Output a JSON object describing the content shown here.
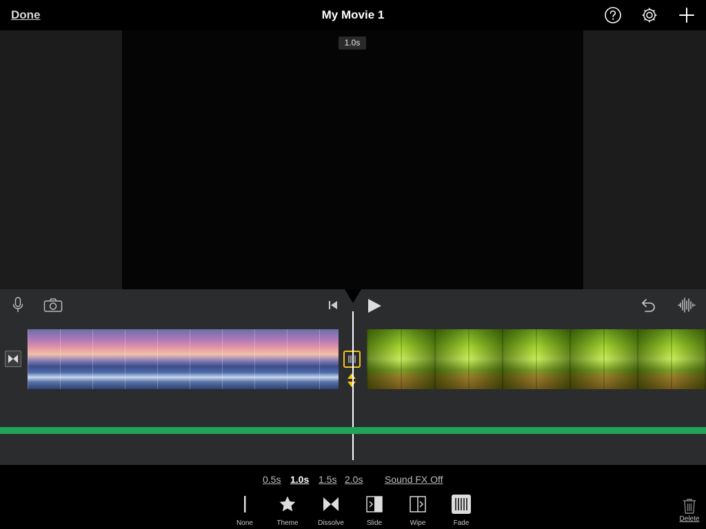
{
  "header": {
    "done_label": "Done",
    "title": "My Movie 1"
  },
  "viewer": {
    "duration_badge": "1.0s"
  },
  "transition": {
    "durations": [
      "0.5s",
      "1.0s",
      "1.5s",
      "2.0s"
    ],
    "selected_duration": "1.0s",
    "sound_fx_label": "Sound FX Off",
    "styles": [
      "None",
      "Theme",
      "Dissolve",
      "Slide",
      "Wipe",
      "Fade"
    ],
    "selected_style": "Fade"
  },
  "actions": {
    "delete_label": "Delete"
  },
  "colors": {
    "accent_yellow": "#f5c518",
    "audio_green": "#21a35a",
    "timeline_bg": "#2a2c2e"
  },
  "icons": {
    "help": "question-circle-icon",
    "settings": "gear-icon",
    "add": "plus-icon",
    "mic": "microphone-icon",
    "camera": "camera-icon",
    "skip_start": "skip-to-start-icon",
    "play": "play-icon",
    "undo": "undo-icon",
    "audio": "waveform-icon",
    "delete": "trash-icon"
  }
}
